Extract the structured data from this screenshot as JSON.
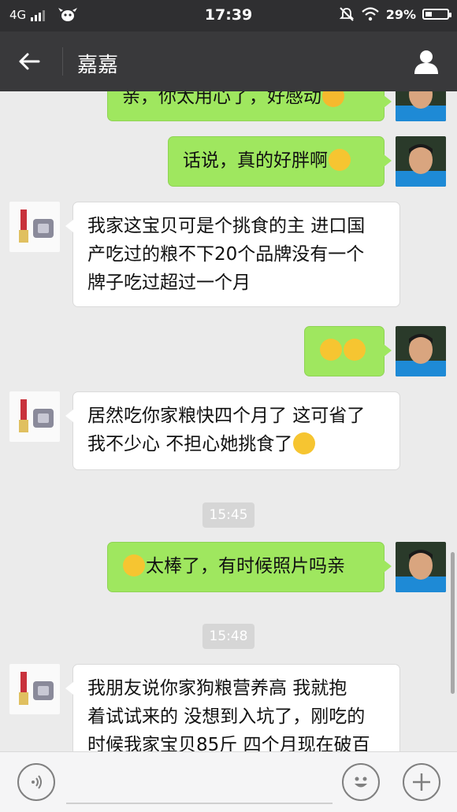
{
  "status_bar": {
    "network": "4G",
    "time": "17:39",
    "battery_percent": "29%",
    "battery_level": 0.29
  },
  "header": {
    "title": "嘉嘉"
  },
  "messages": [
    {
      "type": "out",
      "text": "亲，你太用心了，好感动"
    },
    {
      "type": "out",
      "text": "话说，真的好胖啊"
    },
    {
      "type": "in",
      "lines": [
        "我家这宝贝可是个挑食的主 进口国",
        "产吃过的粮不下20个品牌没有一个",
        "牌子吃过超过一个月"
      ]
    },
    {
      "type": "out",
      "emoji_only": true
    },
    {
      "type": "in",
      "lines": [
        "居然吃你家粮快四个月了 这可省了",
        "我不少心 不担心她挑食了"
      ]
    },
    {
      "type": "time",
      "text": "15:45"
    },
    {
      "type": "out",
      "text": "太棒了，有时候照片吗亲"
    },
    {
      "type": "time",
      "text": "15:48"
    },
    {
      "type": "in",
      "lines": [
        "我朋友说你家狗粮营养高  我就抱",
        "着试试来的 没想到入坑了，刚吃的",
        "时候我家宝贝85斤 四个月现在破百"
      ]
    }
  ],
  "input_bar": {
    "placeholder": ""
  },
  "colors": {
    "outgoing_bubble": "#9fe75f",
    "incoming_bubble": "#ffffff",
    "header_bg": "#39393b",
    "chat_bg": "#ebebeb"
  },
  "icons": [
    "signal-icon",
    "cow-icon",
    "mute-icon",
    "wifi-icon",
    "battery-icon",
    "back-arrow-icon",
    "profile-icon",
    "voice-icon",
    "emoji-icon",
    "plus-icon"
  ]
}
